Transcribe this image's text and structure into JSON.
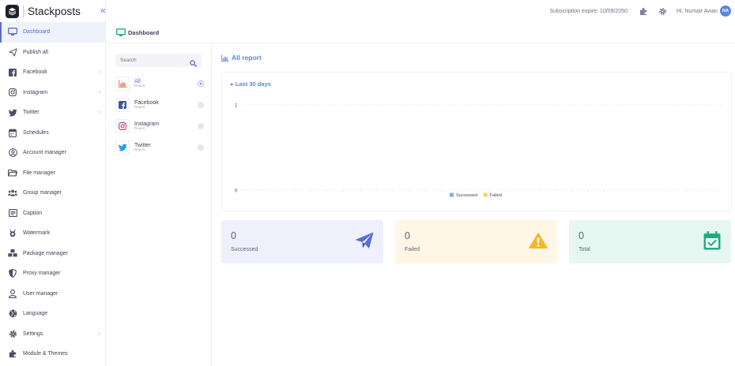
{
  "brand": {
    "name": "Stackposts"
  },
  "topbar": {
    "subscription": "Subscription expire: 10/09/2050",
    "greeting": "Hi, Numair Awan",
    "avatar_initials": "NA"
  },
  "sidebar": {
    "items": [
      {
        "label": "Dashboard",
        "icon": "monitor-icon",
        "active": true
      },
      {
        "label": "Publish all",
        "icon": "send-icon"
      },
      {
        "label": "Facebook",
        "icon": "facebook-icon",
        "chevron": true
      },
      {
        "label": "Instagram",
        "icon": "instagram-icon",
        "chevron": true
      },
      {
        "label": "Twitter",
        "icon": "twitter-icon",
        "chevron": true
      },
      {
        "label": "Schedules",
        "icon": "calendar-icon"
      },
      {
        "label": "Account manager",
        "icon": "user-circle-icon"
      },
      {
        "label": "File manager",
        "icon": "folder-icon"
      },
      {
        "label": "Group manager",
        "icon": "users-icon"
      },
      {
        "label": "Caption",
        "icon": "caption-icon"
      },
      {
        "label": "Watermark",
        "icon": "watermark-icon"
      },
      {
        "label": "Package manager",
        "icon": "package-icon"
      },
      {
        "label": "Proxy manager",
        "icon": "shield-icon"
      },
      {
        "label": "User manager",
        "icon": "user-icon"
      },
      {
        "label": "Language",
        "icon": "globe-icon"
      },
      {
        "label": "Settings",
        "icon": "gear-icon",
        "chevron": true
      },
      {
        "label": "Module & Themes",
        "icon": "puzzle-icon"
      }
    ]
  },
  "breadcrumb": {
    "title": "Dashboard"
  },
  "filter": {
    "search_placeholder": "Search",
    "items": [
      {
        "name": "All",
        "sub": "Report",
        "active": true
      },
      {
        "name": "Facebook",
        "sub": "Report"
      },
      {
        "name": "Instagram",
        "sub": "Report"
      },
      {
        "name": "Twitter",
        "sub": "Report"
      }
    ]
  },
  "main": {
    "title": "All report",
    "range": "Last 30 days"
  },
  "chart_data": {
    "type": "bar",
    "ylim": [
      0,
      1
    ],
    "yticks": [
      "1",
      "0"
    ],
    "grid": true,
    "legend_placement": "bottom",
    "series": [
      {
        "name": "Successed",
        "color": "#8fa8e6"
      },
      {
        "name": "Failed",
        "color": "#f6d36b"
      }
    ]
  },
  "stats": [
    {
      "value": "0",
      "label": "Successed",
      "bg": "#eef0fb",
      "icon": "paper-plane-icon",
      "color": "#5b6bd6"
    },
    {
      "value": "0",
      "label": "Failed",
      "bg": "#fff6e5",
      "icon": "warning-icon",
      "color": "#f7b52c"
    },
    {
      "value": "0",
      "label": "Total",
      "bg": "#e6f7f1",
      "icon": "calendar-check-icon",
      "color": "#1bb07a"
    }
  ]
}
